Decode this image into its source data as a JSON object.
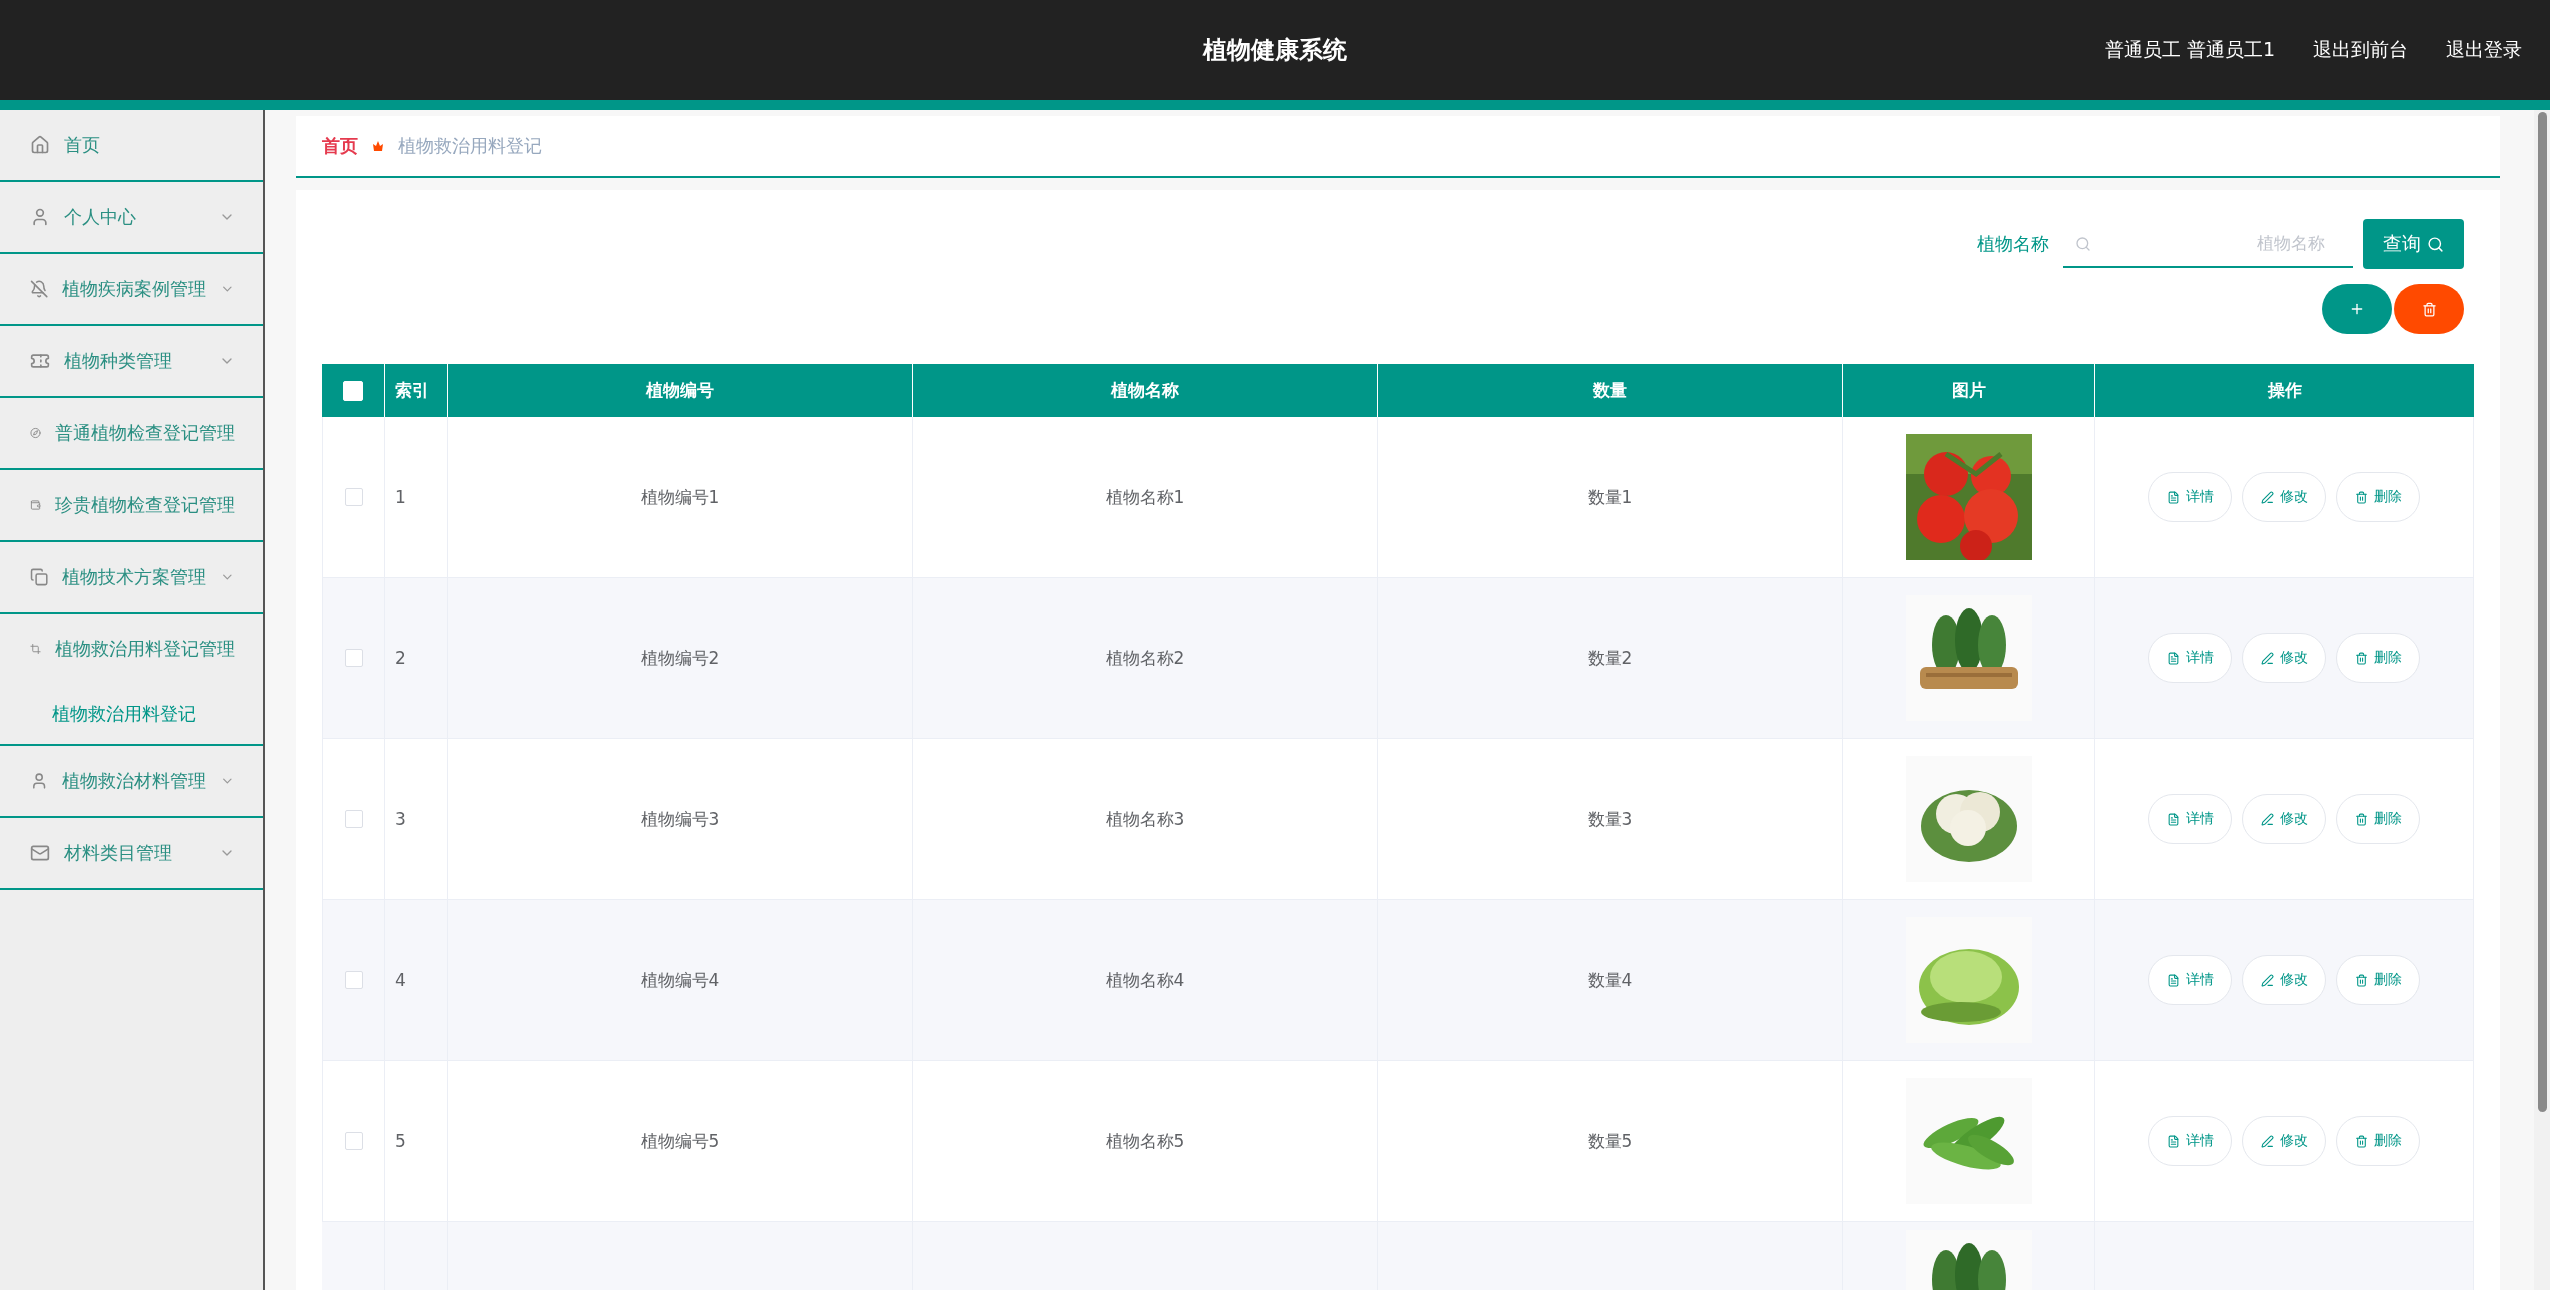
{
  "header": {
    "title": "植物健康系统",
    "user": "普通员工 普通员工1",
    "links": [
      "退出到前台",
      "退出登录"
    ]
  },
  "sidebar": {
    "items": [
      {
        "label": "首页",
        "kind": "link"
      },
      {
        "label": "个人中心",
        "kind": "submenu",
        "expanded": false
      },
      {
        "label": "植物疾病案例管理",
        "kind": "submenu",
        "expanded": false
      },
      {
        "label": "植物种类管理",
        "kind": "submenu",
        "expanded": false
      },
      {
        "label": "普通植物检查登记管理",
        "kind": "link"
      },
      {
        "label": "珍贵植物检查登记管理",
        "kind": "link"
      },
      {
        "label": "植物技术方案管理",
        "kind": "submenu",
        "expanded": false
      },
      {
        "label": "植物救治用料登记管理",
        "kind": "submenu",
        "expanded": true,
        "children": [
          {
            "label": "植物救治用料登记",
            "selected": true
          }
        ]
      },
      {
        "label": "植物救治材料管理",
        "kind": "submenu",
        "expanded": false
      },
      {
        "label": "材料类目管理",
        "kind": "submenu",
        "expanded": false
      }
    ]
  },
  "breadcrumb": [
    "首页",
    "植物救治用料登记"
  ],
  "search": {
    "label": "植物名称",
    "placeholder": "植物名称",
    "button": "查询"
  },
  "table": {
    "columns": [
      "索引",
      "植物编号",
      "植物名称",
      "数量",
      "图片",
      "操作"
    ],
    "header_checked": false,
    "rows": [
      {
        "index": "1",
        "code": "植物编号1",
        "name": "植物名称1",
        "quantity": "数量1",
        "checked": false,
        "actions": [
          "详情",
          "修改",
          "删除"
        ]
      },
      {
        "index": "2",
        "code": "植物编号2",
        "name": "植物名称2",
        "quantity": "数量2",
        "checked": false,
        "actions": [
          "详情",
          "修改",
          "删除"
        ]
      },
      {
        "index": "3",
        "code": "植物编号3",
        "name": "植物名称3",
        "quantity": "数量3",
        "checked": false,
        "actions": [
          "详情",
          "修改",
          "删除"
        ]
      },
      {
        "index": "4",
        "code": "植物编号4",
        "name": "植物名称4",
        "quantity": "数量4",
        "checked": false,
        "actions": [
          "详情",
          "修改",
          "删除"
        ]
      },
      {
        "index": "5",
        "code": "植物编号5",
        "name": "植物名称5",
        "quantity": "数量5",
        "checked": false,
        "actions": [
          "详情",
          "修改",
          "删除"
        ]
      }
    ]
  }
}
